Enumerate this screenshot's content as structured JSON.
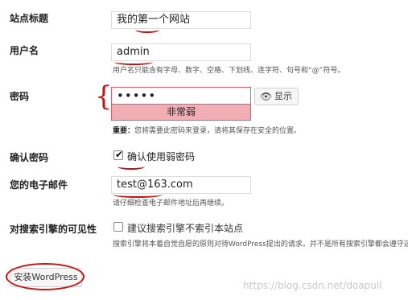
{
  "site_title": {
    "label": "站点标题",
    "value": "我的第一个网站"
  },
  "username": {
    "label": "用户名",
    "value": "admin",
    "hint": "用户名只能含有字母、数字、空格、下划线、连字符、句号和“@”符号。"
  },
  "password": {
    "label": "密码",
    "value": "•••••",
    "strength": "非常弱",
    "show_button": "显示",
    "important_label": "重要：",
    "important_text": "您将需要此密码来登录，请将其保存在安全的位置。"
  },
  "confirm_password": {
    "label": "确认密码",
    "checkbox_label": "确认使用弱密码"
  },
  "email": {
    "label": "您的电子邮件",
    "value": "test@163.com",
    "hint": "请仔细检查电子邮件地址后再继续。"
  },
  "search_visibility": {
    "label": "对搜索引擎的可见性",
    "checkbox_label": "建议搜索引擎不索引本站点",
    "hint": "搜索引擎将本着自觉自愿的原则对待WordPress提出的请求。并不是所有搜索引擎都会遵守这类请"
  },
  "install_button": "安装WordPress",
  "watermark": "https://blog.csdn.net/doapull",
  "colors": {
    "weak_bg": "#f1aeb5",
    "weak_border": "#e35b66",
    "annotation_red": "#cc1111"
  }
}
